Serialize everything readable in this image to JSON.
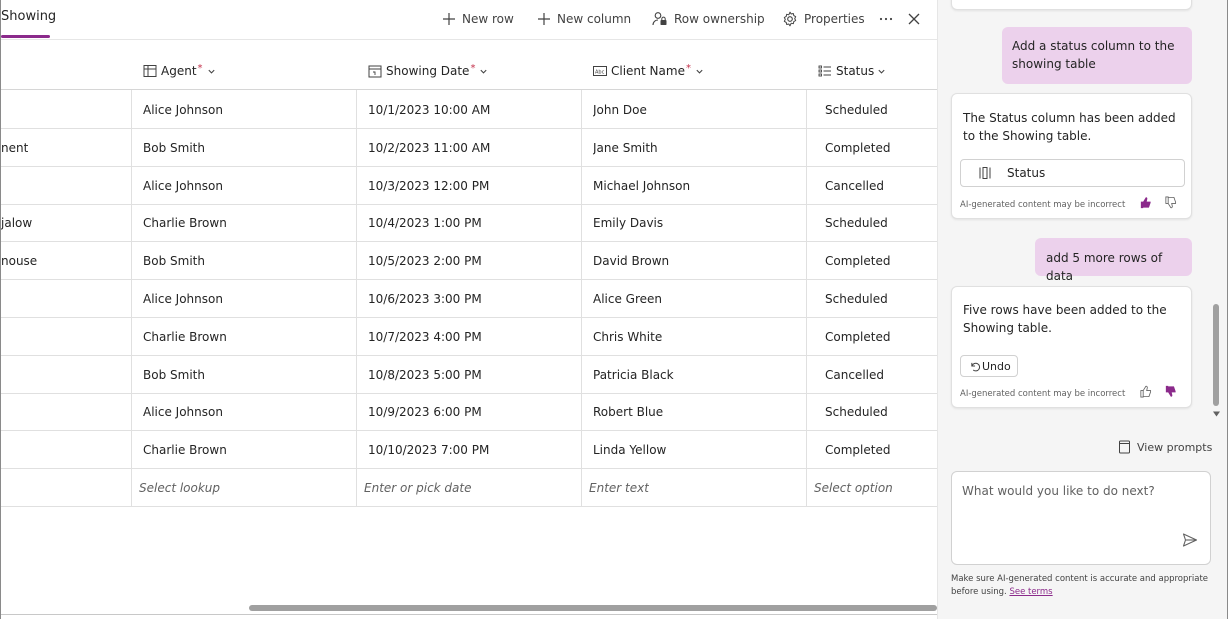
{
  "table": {
    "tab_title": "Showing",
    "toolbar": {
      "new_row": "New row",
      "new_column": "New column",
      "row_ownership": "Row ownership",
      "properties": "Properties"
    },
    "columns": [
      {
        "label": "Agent",
        "required": "*"
      },
      {
        "label": "Showing Date",
        "required": "*"
      },
      {
        "label": "Client Name",
        "required": "*"
      },
      {
        "label": "Status",
        "required": ""
      }
    ],
    "rows": [
      {
        "name_fragment": "",
        "agent": "Alice Johnson",
        "date": "10/1/2023 10:00 AM",
        "client": "John Doe",
        "status": "Scheduled"
      },
      {
        "name_fragment": "nent",
        "agent": "Bob Smith",
        "date": "10/2/2023 11:00 AM",
        "client": "Jane Smith",
        "status": "Completed"
      },
      {
        "name_fragment": "",
        "agent": "Alice Johnson",
        "date": "10/3/2023 12:00 PM",
        "client": "Michael Johnson",
        "status": "Cancelled"
      },
      {
        "name_fragment": "jalow",
        "agent": "Charlie Brown",
        "date": "10/4/2023 1:00 PM",
        "client": "Emily Davis",
        "status": "Scheduled"
      },
      {
        "name_fragment": "nouse",
        "agent": "Bob Smith",
        "date": "10/5/2023 2:00 PM",
        "client": "David Brown",
        "status": "Completed"
      },
      {
        "name_fragment": "",
        "agent": "Alice Johnson",
        "date": "10/6/2023 3:00 PM",
        "client": "Alice Green",
        "status": "Scheduled"
      },
      {
        "name_fragment": "",
        "agent": "Charlie Brown",
        "date": "10/7/2023 4:00 PM",
        "client": "Chris White",
        "status": "Completed"
      },
      {
        "name_fragment": "",
        "agent": "Bob Smith",
        "date": "10/8/2023 5:00 PM",
        "client": "Patricia Black",
        "status": "Cancelled"
      },
      {
        "name_fragment": "",
        "agent": "Alice Johnson",
        "date": "10/9/2023 6:00 PM",
        "client": "Robert Blue",
        "status": "Scheduled"
      },
      {
        "name_fragment": "",
        "agent": "Charlie Brown",
        "date": "10/10/2023 7:00 PM",
        "client": "Linda Yellow",
        "status": "Completed"
      }
    ],
    "new_row_placeholders": {
      "agent": "Select lookup",
      "date": "Enter or pick date",
      "client": "Enter text",
      "status": "Select option"
    }
  },
  "copilot": {
    "messages": [
      {
        "role": "user",
        "text": "Add a status column to the showing table"
      },
      {
        "role": "assistant",
        "text": "The Status column has been added to the Showing table.",
        "chip_label": "Status",
        "disclaimer": "AI-generated content may be incorrect"
      },
      {
        "role": "user",
        "text": "add 5 more rows of data"
      },
      {
        "role": "assistant",
        "text": "Five rows have been added to the Showing table.",
        "chip_label": "Undo",
        "disclaimer": "AI-generated content may be incorrect"
      }
    ],
    "view_prompts": "View prompts",
    "input_placeholder": "What would you like to do next?",
    "footer_text": "Make sure AI-generated content is accurate and appropriate before using.",
    "footer_link": "See terms"
  },
  "colors": {
    "accent": "#8b2a8b",
    "user_bubble": "#ecd1ec",
    "pane_background": "#f5f5f5"
  },
  "icons": [
    "plus-icon",
    "lock-person-icon",
    "gear-icon",
    "more-icon",
    "close-icon",
    "lookup-column-icon",
    "calendar-icon",
    "text-column-icon",
    "choice-column-icon",
    "chevron-down-icon",
    "column-icon",
    "undo-icon",
    "thumbs-up-icon",
    "thumbs-down-icon",
    "prompt-book-icon",
    "send-icon"
  ]
}
